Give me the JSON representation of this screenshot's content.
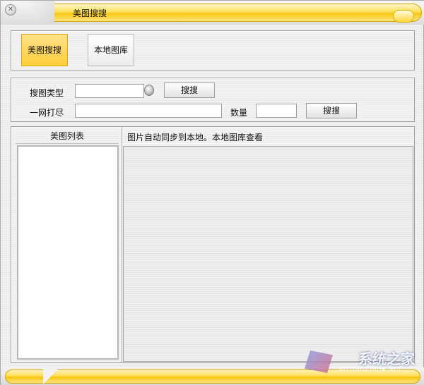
{
  "window": {
    "title": "美图搜搜"
  },
  "tabs": [
    {
      "label": "美图搜搜",
      "active": true
    },
    {
      "label": "本地图库",
      "active": false
    }
  ],
  "search": {
    "type_label": "搜图类型",
    "type_value": "",
    "search_button": "搜搜",
    "keyword_label": "一网打尽",
    "keyword_value": "",
    "count_label": "数量",
    "count_value": "",
    "search_button2": "搜搜"
  },
  "main": {
    "list_title": "美图列表",
    "info_text": "图片自动同步到本地。本地图库查看"
  },
  "watermark": {
    "brand": "系统之家",
    "url": "XITONGZHIJIA.NET"
  },
  "colors": {
    "accent": "#f9c813",
    "accent_light": "#ffe28a",
    "border": "#a0a0a0"
  }
}
